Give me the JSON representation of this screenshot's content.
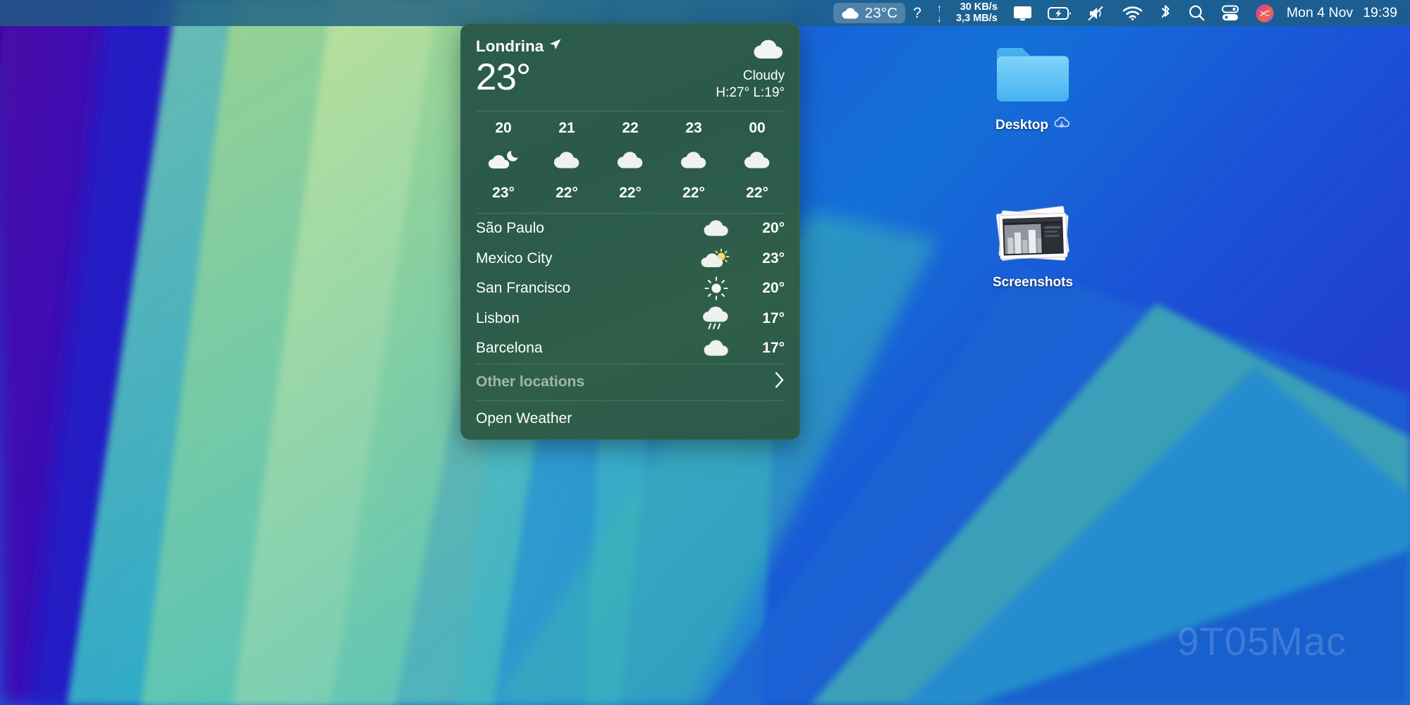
{
  "menubar": {
    "weather": {
      "icon": "cloud-icon",
      "temp": "23°C"
    },
    "help": {
      "icon": "question-mark-icon",
      "label": "?"
    },
    "network": {
      "up_arrow": "↑",
      "up_value": "30 KB/s",
      "down_arrow": "↓",
      "down_value": "3,3 MB/s"
    },
    "display_icon": "display-icon",
    "battery_icon": "battery-charging-icon",
    "sound_icon": "mute-speaker-icon",
    "wifi_icon": "wifi-icon",
    "bluetooth_icon": "bluetooth-icon",
    "search_icon": "search-icon",
    "control_center_icon": "control-center-icon",
    "siri_icon": "siri-icon",
    "date": "Mon 4 Nov",
    "time": "19:39"
  },
  "desktop": {
    "icons": [
      {
        "name": "Desktop",
        "icon": "blue-folder-icon",
        "badge": "icloud-download-icon"
      },
      {
        "name": "Screenshots",
        "icon": "photo-stack-icon",
        "badge": ""
      }
    ],
    "watermark": "9T05Mac"
  },
  "widget": {
    "location": "Londrina",
    "location_arrow": "location-arrow-icon",
    "current_temp": "23°",
    "condition": "Cloudy",
    "condition_icon": "cloud-icon",
    "high_low": "H:27° L:19°",
    "hourly": [
      {
        "hour": "20",
        "icon": "cloud-moon-icon",
        "temp": "23°"
      },
      {
        "hour": "21",
        "icon": "cloud-icon",
        "temp": "22°"
      },
      {
        "hour": "22",
        "icon": "cloud-icon",
        "temp": "22°"
      },
      {
        "hour": "23",
        "icon": "cloud-icon",
        "temp": "22°"
      },
      {
        "hour": "00",
        "icon": "cloud-icon",
        "temp": "22°"
      }
    ],
    "cities": [
      {
        "name": "São Paulo",
        "icon": "cloud-icon",
        "temp": "20°"
      },
      {
        "name": "Mexico City",
        "icon": "cloud-sun-icon",
        "temp": "23°"
      },
      {
        "name": "San Francisco",
        "icon": "sun-icon",
        "temp": "20°"
      },
      {
        "name": "Lisbon",
        "icon": "cloud-rain-icon",
        "temp": "17°"
      },
      {
        "name": "Barcelona",
        "icon": "cloud-icon",
        "temp": "17°"
      }
    ],
    "other_locations": "Other locations",
    "other_locations_chevron": "chevron-right-icon",
    "open_weather": "Open Weather"
  },
  "colors": {
    "widget_green": "#2d5c4d",
    "menubar_blue": "#1e5f82",
    "folder_blue": "#53b9f5"
  }
}
